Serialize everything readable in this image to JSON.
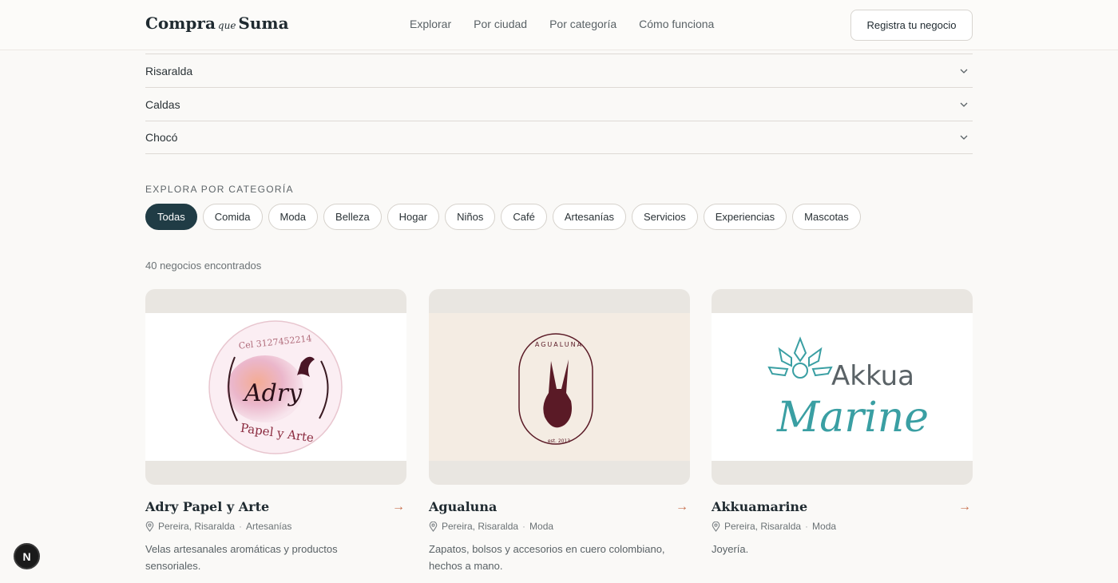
{
  "header": {
    "logo": {
      "part1": "Compra",
      "part2": "que",
      "part3": "Suma"
    },
    "nav": [
      "Explorar",
      "Por ciudad",
      "Por categoría",
      "Cómo funciona"
    ],
    "register_label": "Registra tu negocio"
  },
  "regions": [
    "Risaralda",
    "Caldas",
    "Chocó"
  ],
  "categories": {
    "label": "EXPLORA POR CATEGORÍA",
    "chips": [
      "Todas",
      "Comida",
      "Moda",
      "Belleza",
      "Hogar",
      "Niños",
      "Café",
      "Artesanías",
      "Servicios",
      "Experiencias",
      "Mascotas"
    ],
    "active": "Todas"
  },
  "results_count": "40 negocios encontrados",
  "cards": [
    {
      "title": "Adry Papel y Arte",
      "location": "Pereira, Risaralda",
      "category": "Artesanías",
      "description": "Velas artesanales aromáticas y productos sensoriales.",
      "logo_text": {
        "phone": "Cel 3127452214",
        "name": "Adry",
        "sub": "Papel y Arte"
      }
    },
    {
      "title": "Agualuna",
      "location": "Pereira, Risaralda",
      "category": "Moda",
      "description": "Zapatos, bolsos y accesorios en cuero colombiano, hechos a mano.",
      "logo_text": {
        "name": "AGUALUNA",
        "est": "est. 2013"
      }
    },
    {
      "title": "Akkuamarine",
      "location": "Pereira, Risaralda",
      "category": "Moda",
      "description": "Joyería.",
      "logo_text": {
        "top": "Akkua",
        "bottom": "Marine"
      }
    }
  ],
  "badge": "N",
  "colors": {
    "accent": "#203c45",
    "arrow": "#c9704e",
    "teal": "#3a9fa3",
    "rose": "#7a2a3a"
  }
}
